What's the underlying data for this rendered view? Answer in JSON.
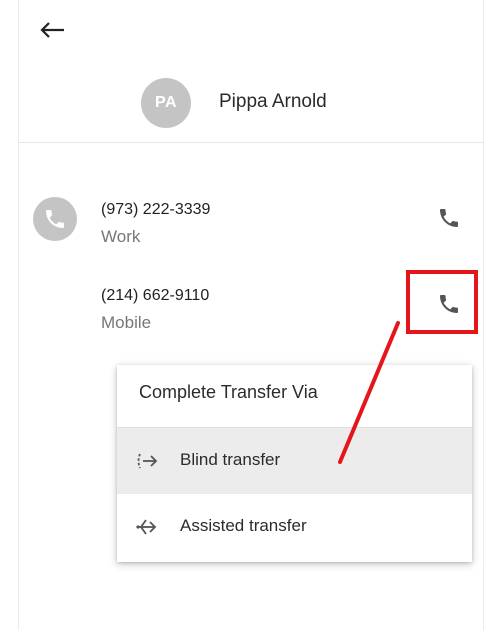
{
  "header": {
    "back_icon": "arrow-left-icon",
    "avatar_initials": "PA",
    "contact_name": "Pippa Arnold"
  },
  "phones": [
    {
      "number": "(973) 222-3339",
      "type": "Work"
    },
    {
      "number": "(214) 662-9110",
      "type": "Mobile"
    }
  ],
  "menu": {
    "title": "Complete Transfer Via",
    "items": [
      {
        "label": "Blind transfer",
        "icon": "blind-transfer-icon",
        "selected": true
      },
      {
        "label": "Assisted transfer",
        "icon": "assisted-transfer-icon",
        "selected": false
      }
    ]
  },
  "colors": {
    "avatar_bg": "#c4c4c4",
    "icon": "#555555",
    "highlight": "#e4161b",
    "selected_bg": "#ececec"
  }
}
